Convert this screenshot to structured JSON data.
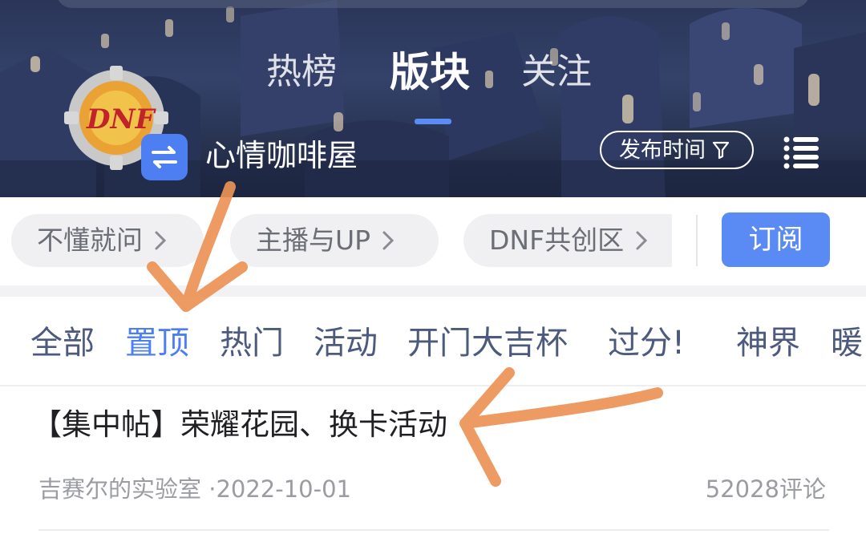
{
  "header": {
    "tabs": [
      {
        "label": "热榜",
        "active": false
      },
      {
        "label": "版块",
        "active": true
      },
      {
        "label": "关注",
        "active": false
      }
    ],
    "logo_text": "DNF",
    "board_name": "心情咖啡屋",
    "sort_label": "发布时间",
    "icons": {
      "switch": "switch-arrows-icon",
      "filter": "filter-icon",
      "menu": "menu-icon"
    }
  },
  "chips": [
    {
      "label": "不懂就问"
    },
    {
      "label": "主播与UP"
    },
    {
      "label": "DNF共创区"
    }
  ],
  "subscribe_label": "订阅",
  "categories": [
    {
      "label": "全部",
      "active": false
    },
    {
      "label": "置顶",
      "active": true
    },
    {
      "label": "热门",
      "active": false
    },
    {
      "label": "活动",
      "active": false
    },
    {
      "label": "开门大吉杯",
      "active": false
    },
    {
      "label": "过分!",
      "active": false
    },
    {
      "label": "神界",
      "active": false
    },
    {
      "label": "暖",
      "active": false
    }
  ],
  "post": {
    "title": "【集中帖】荣耀花园、换卡活动",
    "author": "吉赛尔的实验室",
    "date": "·2022-10-01",
    "comments": "52028评论"
  },
  "colors": {
    "accent": "#4d7ff3",
    "annotation_arrow": "#ec9356",
    "category_text": "#4c5a7e"
  }
}
